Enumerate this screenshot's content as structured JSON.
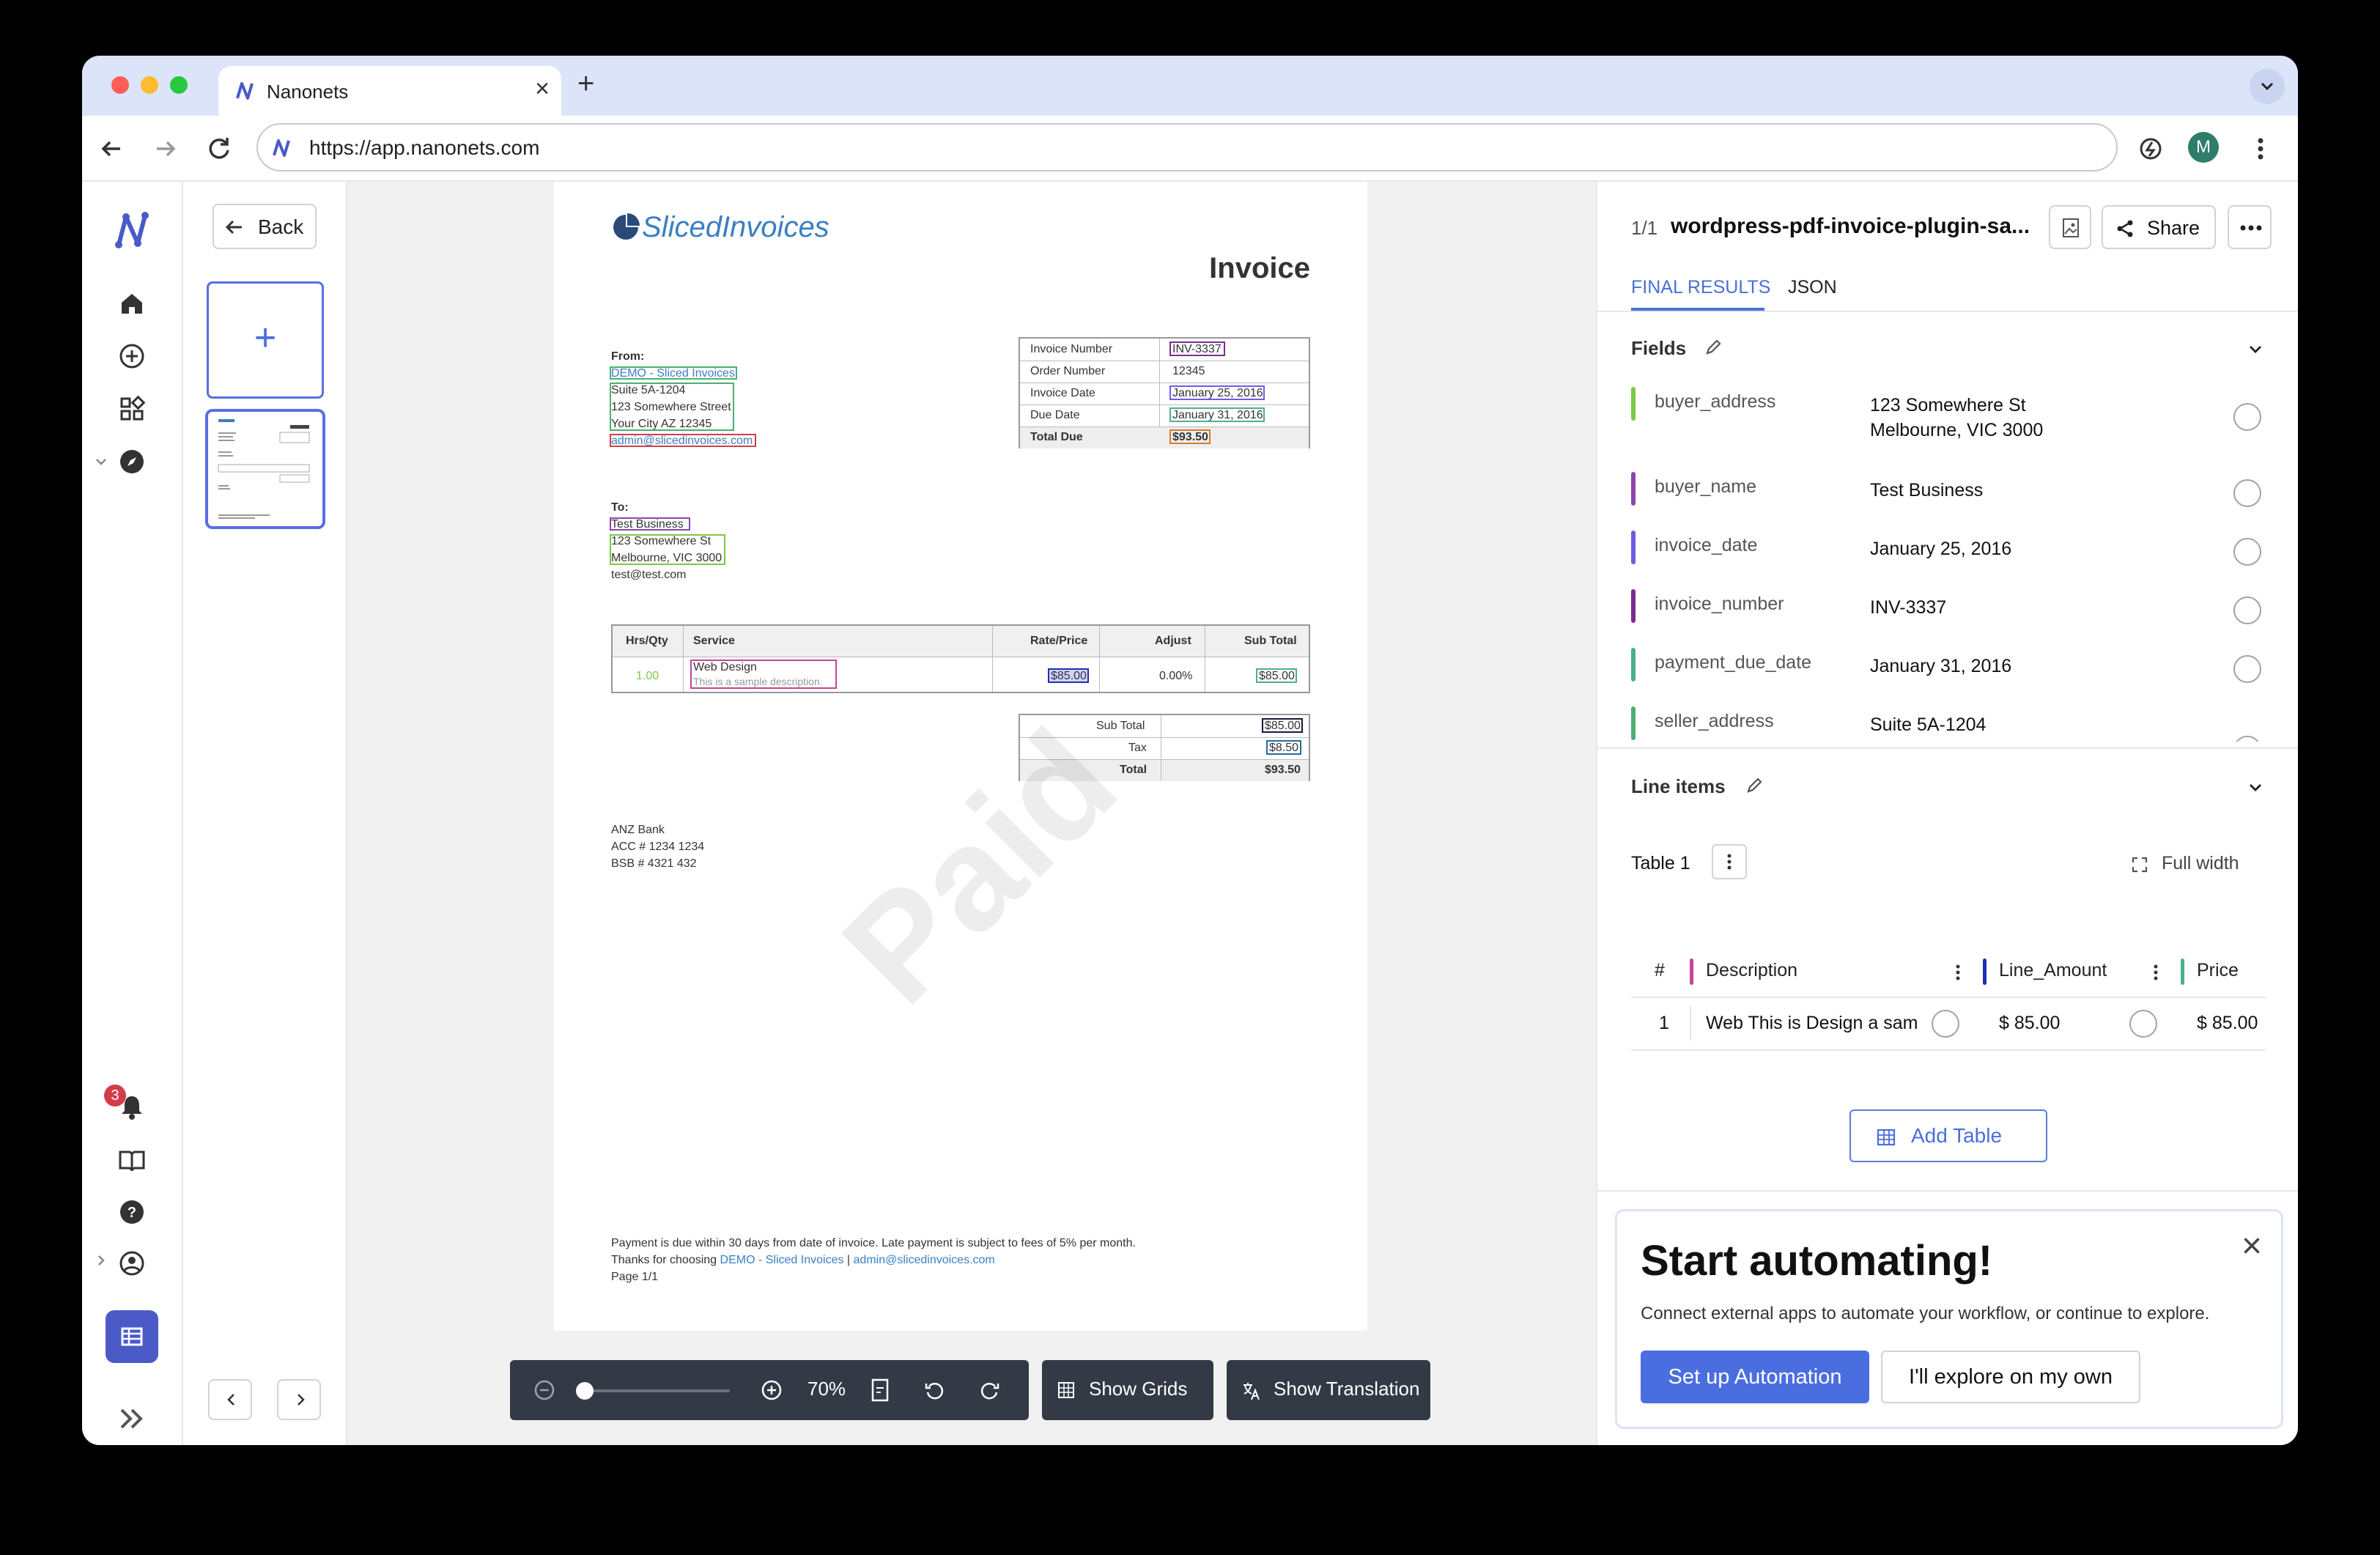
{
  "browser": {
    "tab_title": "Nanonets",
    "url": "https://app.nanonets.com",
    "profile_initial": "M"
  },
  "sidebar": {
    "notification_count": "3"
  },
  "thumbs": {
    "back_label": "Back",
    "add_label": "+"
  },
  "document": {
    "logo_text": "SlicedInvoices",
    "title": "Invoice",
    "from_label": "From:",
    "from_lines": [
      "DEMO - Sliced Invoices",
      "Suite 5A-1204",
      "123 Somewhere Street",
      "Your City AZ 12345",
      "admin@slicedinvoices.com"
    ],
    "to_label": "To:",
    "to_lines": [
      "Test Business",
      "123 Somewhere St",
      "Melbourne, VIC 3000",
      "test@test.com"
    ],
    "meta": [
      {
        "label": "Invoice Number",
        "value": "INV-3337"
      },
      {
        "label": "Order Number",
        "value": "12345"
      },
      {
        "label": "Invoice Date",
        "value": "January 25, 2016"
      },
      {
        "label": "Due Date",
        "value": "January 31, 2016"
      },
      {
        "label": "Total Due",
        "value": "$93.50"
      }
    ],
    "items_headers": [
      "Hrs/Qty",
      "Service",
      "Rate/Price",
      "Adjust",
      "Sub Total"
    ],
    "item": {
      "qty": "1.00",
      "service": "Web Design",
      "description": "This is a sample description.",
      "rate": "$85.00",
      "adjust": "0.00%",
      "subtotal": "$85.00"
    },
    "totals": [
      {
        "label": "Sub Total",
        "value": "$85.00"
      },
      {
        "label": "Tax",
        "value": "$8.50"
      },
      {
        "label": "Total",
        "value": "$93.50"
      }
    ],
    "bank_lines": [
      "ANZ Bank",
      "ACC # 1234 1234",
      "BSB # 4321 432"
    ],
    "footer_line1": "Payment is due within 30 days from date of invoice. Late payment is subject to fees of 5% per month.",
    "footer_line2_prefix": "Thanks for choosing",
    "footer_line2_company": "DEMO - Sliced Invoices",
    "footer_line2_sep": "|",
    "footer_line2_email": "admin@slicedinvoices.com",
    "footer_line3": "Page 1/1",
    "watermark": "Paid"
  },
  "viewer_toolbar": {
    "zoom": "70%",
    "zoom_slider_fraction": 0.0,
    "show_grids": "Show Grids",
    "show_translation": "Show Translation"
  },
  "panel": {
    "page_count": "1/1",
    "file_name": "wordpress-pdf-invoice-plugin-sa...",
    "share_label": "Share",
    "tabs": [
      "FINAL RESULTS",
      "JSON"
    ],
    "fields_title": "Fields",
    "fields": [
      {
        "key": "buyer_address",
        "value_line1": "123 Somewhere St",
        "value_line2": "Melbourne, VIC 3000",
        "color": "#7bc843"
      },
      {
        "key": "buyer_name",
        "value_line1": "Test Business",
        "value_line2": "",
        "color": "#8e44ad"
      },
      {
        "key": "invoice_date",
        "value_line1": "January 25, 2016",
        "value_line2": "",
        "color": "#6c5ce7"
      },
      {
        "key": "invoice_number",
        "value_line1": "INV-3337",
        "value_line2": "",
        "color": "#7b2d8e"
      },
      {
        "key": "payment_due_date",
        "value_line1": "January 31, 2016",
        "value_line2": "",
        "color": "#4caf93"
      },
      {
        "key": "seller_address",
        "value_line1": "Suite 5A-1204",
        "value_line2": "",
        "color": "#4caf73"
      }
    ],
    "line_items_title": "Line items",
    "table_label": "Table 1",
    "full_width_label": "Full width",
    "columns": [
      {
        "name": "#",
        "color": ""
      },
      {
        "name": "Description",
        "color": "#c2449b"
      },
      {
        "name": "Line_Amount",
        "color": "#1c2fb8"
      },
      {
        "name": "Price",
        "color": "#4caf93"
      }
    ],
    "rows": [
      {
        "index": "1",
        "description": "Web This is Design a sam",
        "line_amount": "$ 85.00",
        "price": "$ 85.00"
      }
    ],
    "add_table_label": "Add Table"
  },
  "automation": {
    "title": "Start automating!",
    "subtitle": "Connect external apps to automate your workflow, or continue to explore.",
    "primary_label": "Set up Automation",
    "secondary_label": "I'll explore on my own"
  }
}
